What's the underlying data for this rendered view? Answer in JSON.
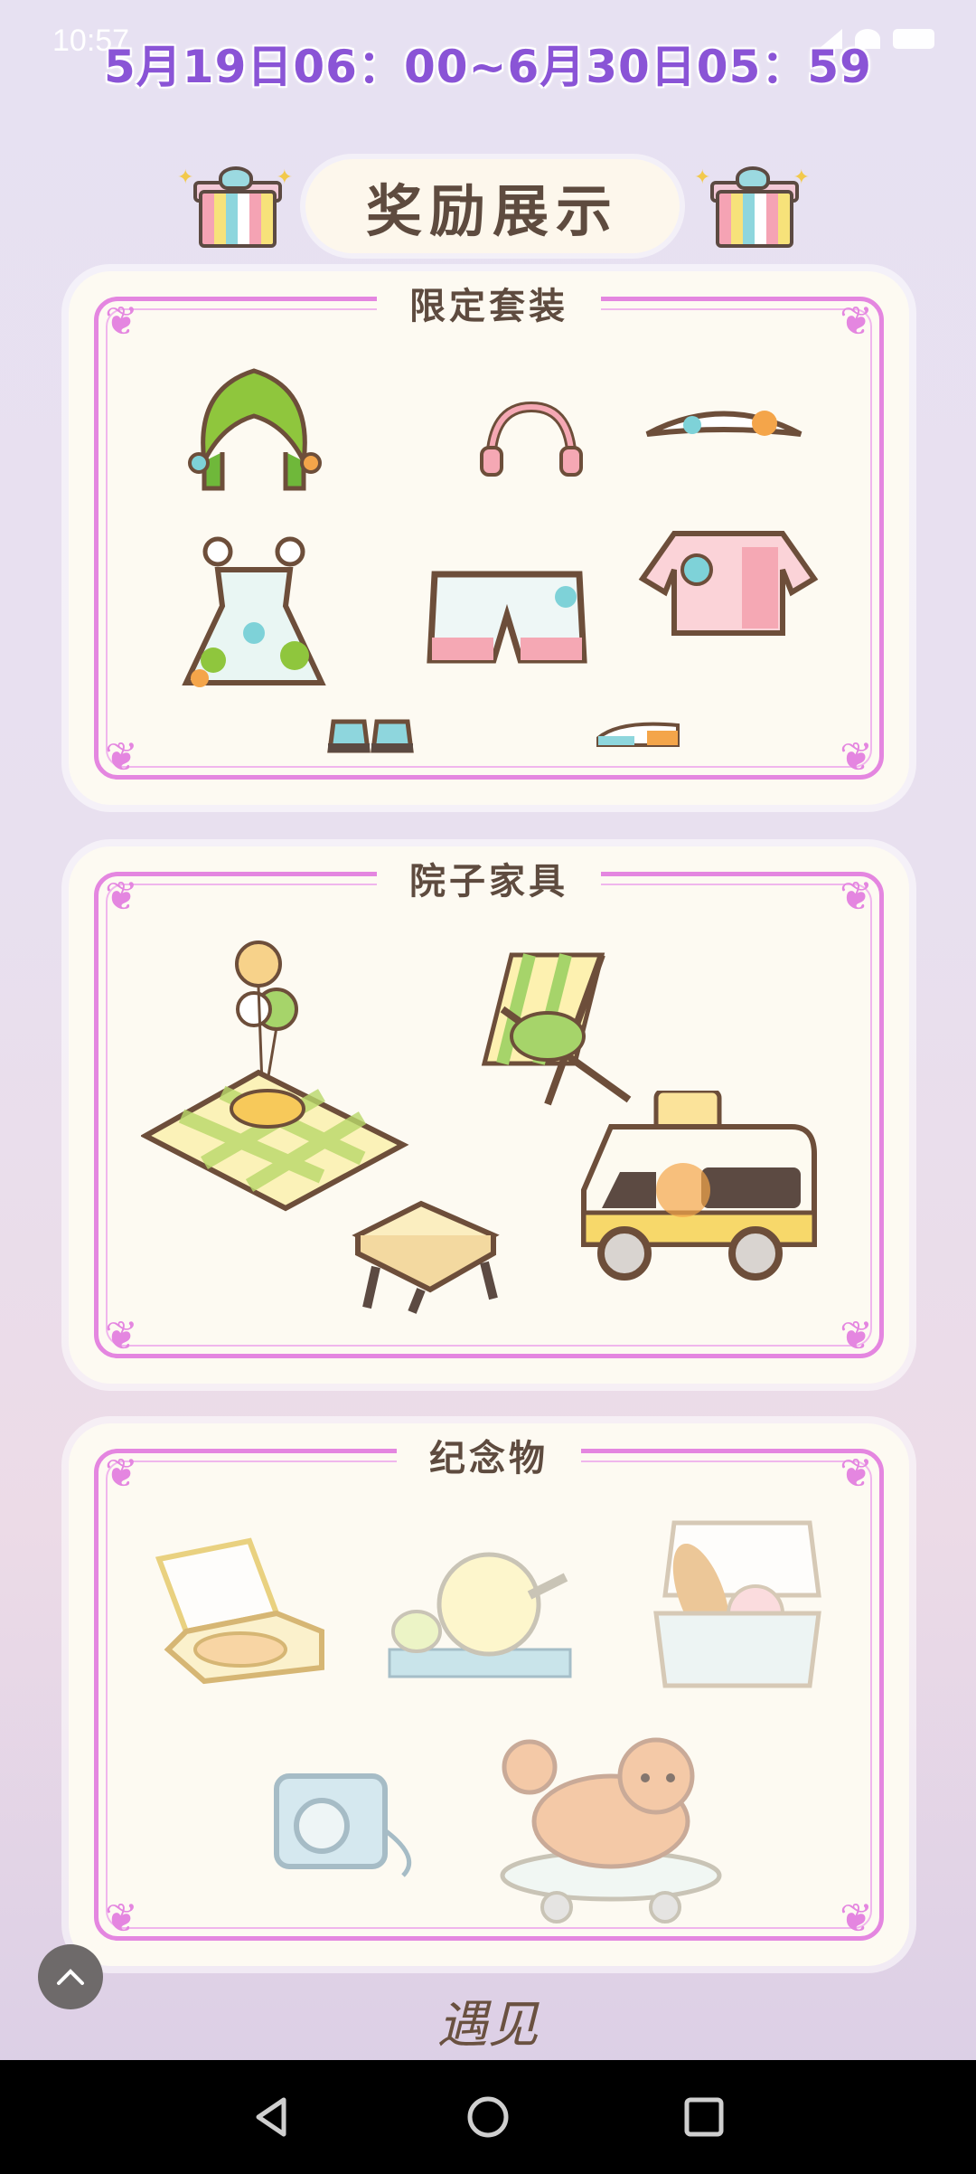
{
  "status_bar": {
    "time": "10:57"
  },
  "event": {
    "date_range": "5月19日06：00~6月30日05：59"
  },
  "header": {
    "title": "奖励展示"
  },
  "sections": {
    "outfit": {
      "title": "限定套装"
    },
    "furniture": {
      "title": "院子家具"
    },
    "souvenir": {
      "title": "纪念物"
    }
  },
  "footer": {
    "signature": "遇见"
  },
  "icons": {
    "gift": "gift-icon",
    "scroll_top": "chevron-up-icon",
    "back": "nav-back-icon",
    "home": "nav-home-icon",
    "recents": "nav-recents-icon"
  },
  "colors": {
    "date_text": "#8a54d6",
    "frame": "#e486e0",
    "title_text": "#5e4b3f",
    "card_bg": "#fdfaf2"
  }
}
